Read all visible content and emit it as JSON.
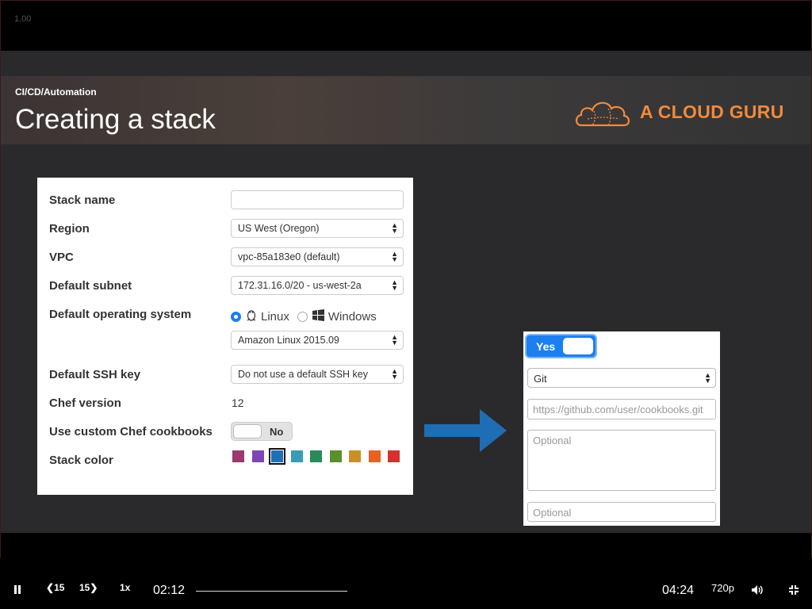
{
  "player": {
    "zoom": "1.00",
    "current_time": "02:12",
    "duration": "04:24",
    "quality": "720p",
    "speed": "1x",
    "skip_back": "15",
    "skip_forward": "15",
    "progress_fraction": 0.5
  },
  "slide": {
    "category": "CI/CD/Automation",
    "title": "Creating a stack",
    "logo_text": "A CLOUD GURU",
    "brand_color": "#f08a3c"
  },
  "stack_form": {
    "stack_name_label": "Stack name",
    "stack_name_value": "",
    "region_label": "Region",
    "region_value": "US West (Oregon)",
    "vpc_label": "VPC",
    "vpc_value": "vpc-85a183e0 (default)",
    "subnet_label": "Default subnet",
    "subnet_value": "172.31.16.0/20 - us-west-2a",
    "os_label": "Default operating system",
    "os_linux": "Linux",
    "os_windows": "Windows",
    "os_selected": "Linux",
    "os_image_value": "Amazon Linux 2015.09",
    "ssh_label": "Default SSH key",
    "ssh_value": "Do not use a default SSH key",
    "chef_label": "Chef version",
    "chef_value": "12",
    "custom_cookbooks_label": "Use custom Chef cookbooks",
    "custom_cookbooks_toggle": "No",
    "stack_color_label": "Stack color",
    "stack_colors": [
      "#9b3a6b",
      "#7e45b5",
      "#1f6fb8",
      "#3a9bb5",
      "#2a8a5a",
      "#5a8f2e",
      "#c9902a",
      "#e5621f",
      "#d0342c"
    ],
    "stack_color_selected_index": 2
  },
  "cookbook_panel": {
    "toggle_label": "Yes",
    "repo_type": "Git",
    "repo_url_placeholder": "https://github.com/user/cookbooks.git",
    "ssh_key_placeholder": "Optional",
    "branch_placeholder": "Optional"
  }
}
